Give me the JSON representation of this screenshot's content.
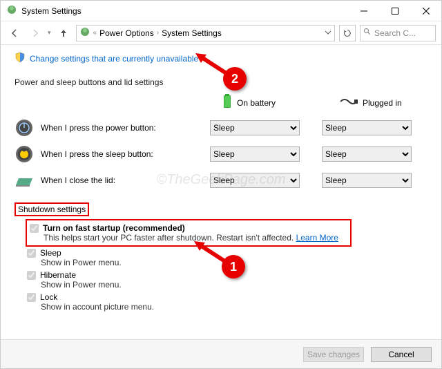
{
  "window": {
    "title": "System Settings"
  },
  "breadcrumb": {
    "item1": "Power Options",
    "item2": "System Settings"
  },
  "search": {
    "placeholder": "Search C..."
  },
  "change_link": {
    "text": "Change settings that are currently unavailable"
  },
  "section_header": "Power and sleep buttons and lid settings",
  "col_battery": "On battery",
  "col_plugged": "Plugged in",
  "rows": {
    "power_btn": "When I press the power button:",
    "sleep_btn": "When I press the sleep button:",
    "lid": "When I close the lid:"
  },
  "dropdown_value": "Sleep",
  "shutdown": {
    "header": "Shutdown settings",
    "fast_startup": {
      "label": "Turn on fast startup (recommended)",
      "desc": "This helps start your PC faster after shutdown. Restart isn't affected.",
      "learn": "Learn More"
    },
    "sleep": {
      "label": "Sleep",
      "desc": "Show in Power menu."
    },
    "hibernate": {
      "label": "Hibernate",
      "desc": "Show in Power menu."
    },
    "lock": {
      "label": "Lock",
      "desc": "Show in account picture menu."
    }
  },
  "buttons": {
    "save": "Save changes",
    "cancel": "Cancel"
  },
  "annotations": {
    "one": "1",
    "two": "2"
  },
  "watermark": "©TheGeekPage.com"
}
